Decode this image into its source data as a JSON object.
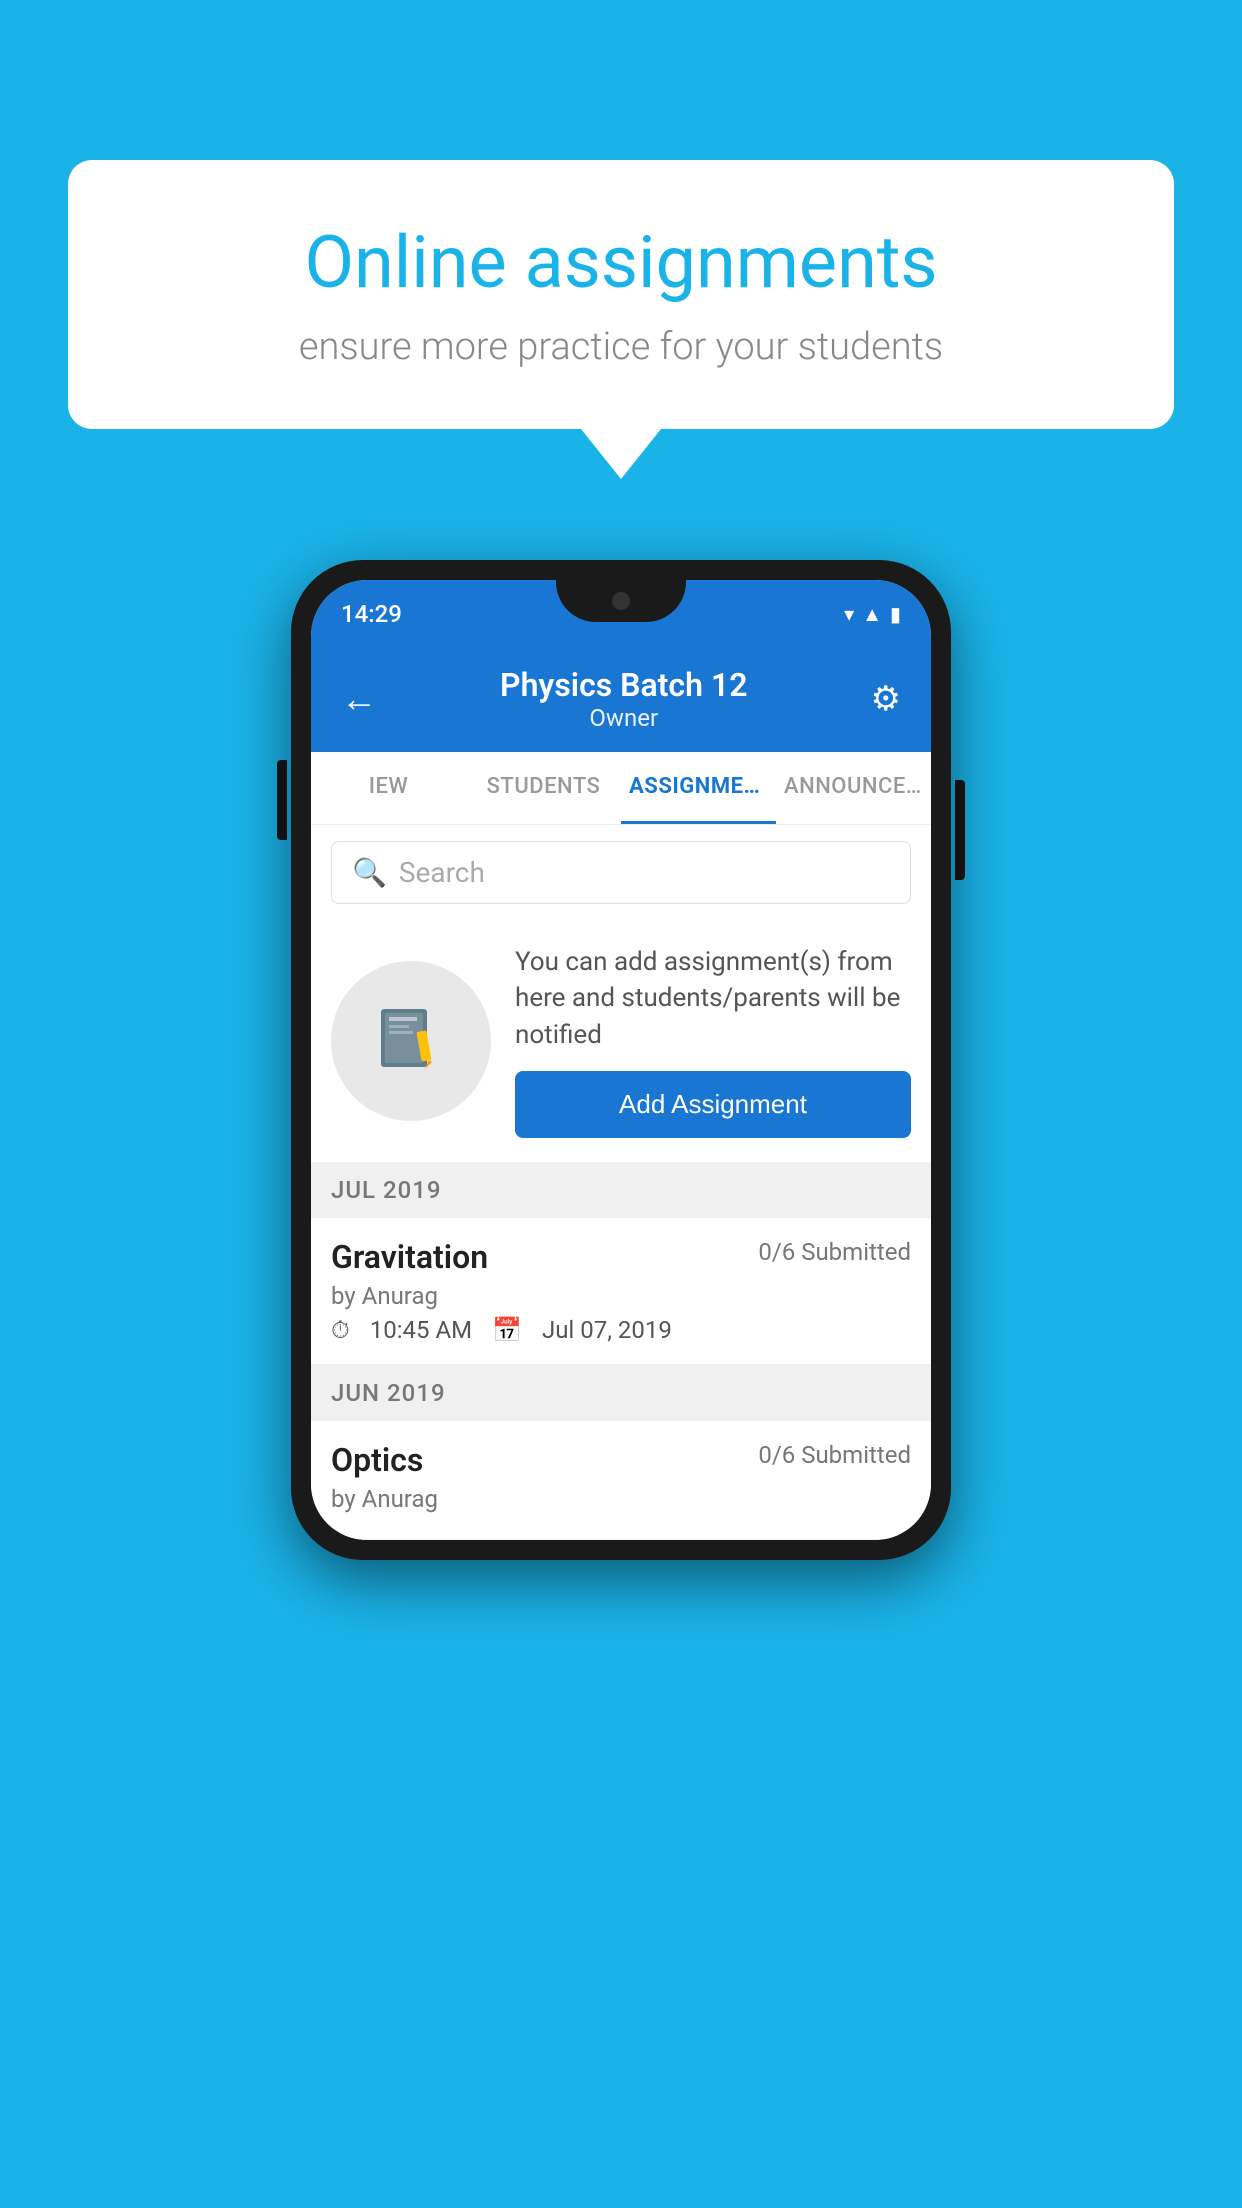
{
  "background": {
    "color": "#1ab3e8"
  },
  "speech_bubble": {
    "title": "Online assignments",
    "subtitle": "ensure more practice for your students"
  },
  "phone": {
    "status_bar": {
      "time": "14:29",
      "icons": [
        "wifi",
        "signal",
        "battery"
      ]
    },
    "header": {
      "title": "Physics Batch 12",
      "subtitle": "Owner",
      "back_label": "←",
      "gear_label": "⚙"
    },
    "tabs": [
      {
        "label": "IEW",
        "active": false
      },
      {
        "label": "STUDENTS",
        "active": false
      },
      {
        "label": "ASSIGNMENTS",
        "active": true
      },
      {
        "label": "ANNOUNCEMENTS",
        "active": false
      }
    ],
    "search": {
      "placeholder": "Search"
    },
    "info_card": {
      "description": "You can add assignment(s) from here and students/parents will be notified",
      "button_label": "Add Assignment"
    },
    "sections": [
      {
        "month_label": "JUL 2019",
        "assignments": [
          {
            "title": "Gravitation",
            "submitted": "0/6 Submitted",
            "by": "by Anurag",
            "time": "10:45 AM",
            "date": "Jul 07, 2019"
          }
        ]
      },
      {
        "month_label": "JUN 2019",
        "assignments": [
          {
            "title": "Optics",
            "submitted": "0/6 Submitted",
            "by": "by Anurag",
            "time": "",
            "date": ""
          }
        ]
      }
    ]
  }
}
